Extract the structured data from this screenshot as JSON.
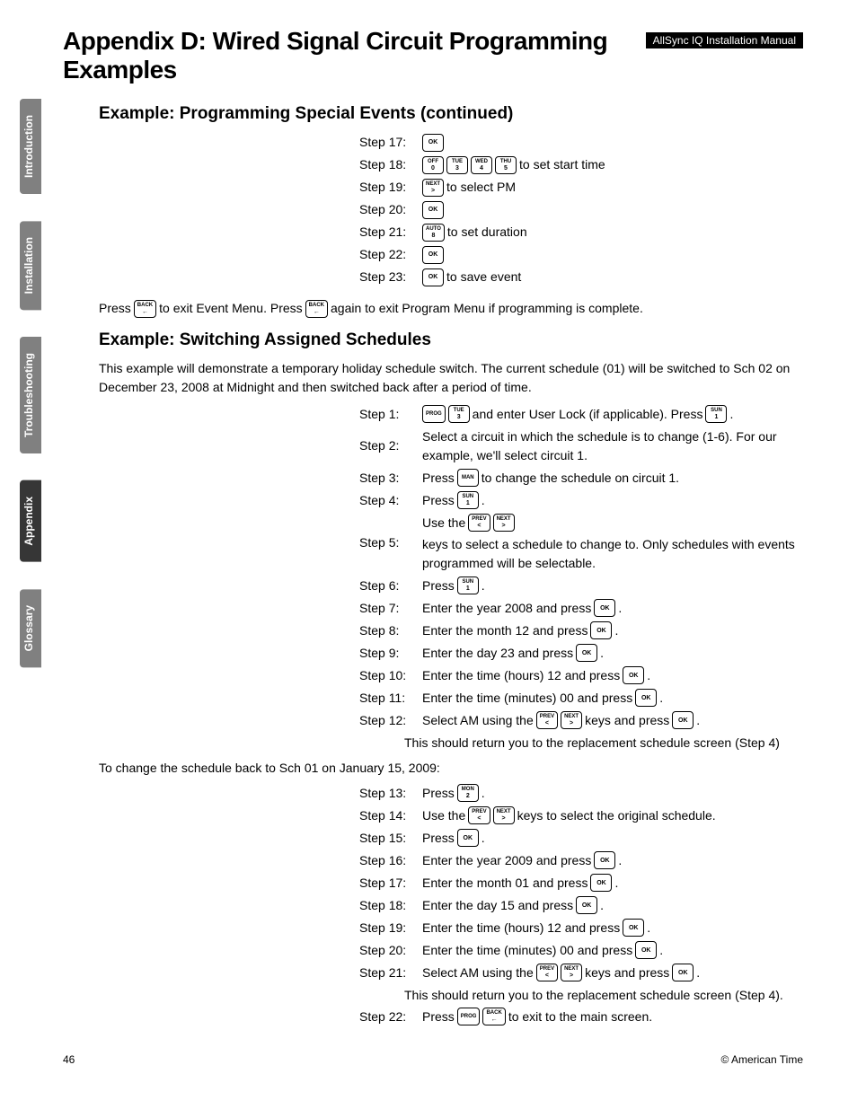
{
  "header": {
    "title": "Appendix D: Wired Signal Circuit Programming Examples",
    "badge": "AllSync IQ Installation Manual"
  },
  "tabs": [
    "Introduction",
    "Installation",
    "Troubleshooting",
    "Appendix",
    "Glossary"
  ],
  "active_tab": "Appendix",
  "section1": {
    "subtitle": "Example: Programming Special Events (continued)",
    "steps": [
      {
        "n": "Step 17:",
        "items": [
          {
            "t": "key",
            "top": "OK"
          }
        ]
      },
      {
        "n": "Step 18:",
        "items": [
          {
            "t": "key",
            "top": "OFF",
            "bot": "0"
          },
          {
            "t": "key",
            "top": "TUE",
            "bot": "3"
          },
          {
            "t": "key",
            "top": "WED",
            "bot": "4"
          },
          {
            "t": "key",
            "top": "THU",
            "bot": "5"
          },
          {
            "t": "text",
            "v": " to set start time"
          }
        ]
      },
      {
        "n": "Step 19:",
        "items": [
          {
            "t": "key",
            "top": "NEXT",
            "bot": ">"
          },
          {
            "t": "text",
            "v": " to select PM"
          }
        ]
      },
      {
        "n": "Step 20:",
        "items": [
          {
            "t": "key",
            "top": "OK"
          }
        ]
      },
      {
        "n": "Step 21:",
        "items": [
          {
            "t": "key",
            "top": "AUTO",
            "bot": "8"
          },
          {
            "t": "text",
            "v": " to set duration"
          }
        ]
      },
      {
        "n": "Step 22:",
        "items": [
          {
            "t": "key",
            "top": "OK"
          }
        ]
      },
      {
        "n": "Step 23:",
        "items": [
          {
            "t": "key",
            "top": "OK"
          },
          {
            "t": "text",
            "v": " to save event"
          }
        ]
      }
    ],
    "exit_line": [
      {
        "t": "text",
        "v": "Press "
      },
      {
        "t": "key",
        "top": "BACK",
        "bot": "←"
      },
      {
        "t": "text",
        "v": " to exit Event Menu. Press "
      },
      {
        "t": "key",
        "top": "BACK",
        "bot": "←"
      },
      {
        "t": "text",
        "v": " again to exit Program Menu if programming is complete."
      }
    ]
  },
  "section2": {
    "subtitle": "Example: Switching Assigned Schedules",
    "intro": "This example will demonstrate a temporary holiday schedule switch. The current schedule (01) will be switched to Sch 02 on December 23, 2008 at Midnight and then switched back after a period of time.",
    "stepsA": [
      {
        "n": "Step 1:",
        "items": [
          {
            "t": "key",
            "top": "PROG"
          },
          {
            "t": "key",
            "top": "TUE",
            "bot": "3"
          },
          {
            "t": "text",
            "v": " and enter User Lock (if applicable). Press "
          },
          {
            "t": "key",
            "top": "SUN",
            "bot": "1"
          },
          {
            "t": "text",
            "v": "."
          }
        ]
      },
      {
        "n": "Step 2:",
        "items": [
          {
            "t": "text",
            "v": "Select a circuit in which the schedule is to change (1-6). For our example, we'll select circuit 1."
          }
        ]
      },
      {
        "n": "Step 3:",
        "items": [
          {
            "t": "text",
            "v": "Press "
          },
          {
            "t": "key",
            "top": "MAN"
          },
          {
            "t": "text",
            "v": " to change the schedule on circuit 1."
          }
        ]
      },
      {
        "n": "Step 4:",
        "items": [
          {
            "t": "text",
            "v": "Press "
          },
          {
            "t": "key",
            "top": "SUN",
            "bot": "1"
          },
          {
            "t": "text",
            "v": "."
          }
        ]
      },
      {
        "n": "Step 5:",
        "items": [
          {
            "t": "text",
            "v": "Use the "
          },
          {
            "t": "key",
            "top": "PREV",
            "bot": "<"
          },
          {
            "t": "key",
            "top": "NEXT",
            "bot": ">"
          },
          {
            "t": "text",
            "v": " keys to select a schedule to change to. Only schedules with events programmed will be selectable."
          }
        ]
      },
      {
        "n": "Step 6:",
        "items": [
          {
            "t": "text",
            "v": "Press "
          },
          {
            "t": "key",
            "top": "SUN",
            "bot": "1"
          },
          {
            "t": "text",
            "v": "."
          }
        ]
      },
      {
        "n": "Step 7:",
        "items": [
          {
            "t": "text",
            "v": "Enter the year 2008 and press "
          },
          {
            "t": "key",
            "top": "OK"
          },
          {
            "t": "text",
            "v": "."
          }
        ]
      },
      {
        "n": "Step 8:",
        "items": [
          {
            "t": "text",
            "v": "Enter the month 12 and press "
          },
          {
            "t": "key",
            "top": "OK"
          },
          {
            "t": "text",
            "v": "."
          }
        ]
      },
      {
        "n": "Step 9:",
        "items": [
          {
            "t": "text",
            "v": "Enter the day 23 and press "
          },
          {
            "t": "key",
            "top": "OK"
          },
          {
            "t": "text",
            "v": "."
          }
        ]
      },
      {
        "n": "Step 10:",
        "items": [
          {
            "t": "text",
            "v": "Enter the time (hours) 12 and press "
          },
          {
            "t": "key",
            "top": "OK"
          },
          {
            "t": "text",
            "v": "."
          }
        ]
      },
      {
        "n": "Step 11:",
        "items": [
          {
            "t": "text",
            "v": "Enter the time (minutes) 00 and press "
          },
          {
            "t": "key",
            "top": "OK"
          },
          {
            "t": "text",
            "v": "."
          }
        ]
      },
      {
        "n": "Step 12:",
        "items": [
          {
            "t": "text",
            "v": "Select AM using the "
          },
          {
            "t": "key",
            "top": "PREV",
            "bot": "<"
          },
          {
            "t": "key",
            "top": "NEXT",
            "bot": ">"
          },
          {
            "t": "text",
            "v": " keys and press "
          },
          {
            "t": "key",
            "top": "OK"
          },
          {
            "t": "text",
            "v": "."
          }
        ]
      }
    ],
    "noteA": "This should return you to the replacement schedule screen (Step 4)",
    "mid_note": "To change the schedule back to Sch 01 on January 15, 2009:",
    "stepsB": [
      {
        "n": "Step 13:",
        "items": [
          {
            "t": "text",
            "v": "Press "
          },
          {
            "t": "key",
            "top": "MON",
            "bot": "2"
          },
          {
            "t": "text",
            "v": "."
          }
        ]
      },
      {
        "n": "Step 14:",
        "items": [
          {
            "t": "text",
            "v": "Use the "
          },
          {
            "t": "key",
            "top": "PREV",
            "bot": "<"
          },
          {
            "t": "key",
            "top": "NEXT",
            "bot": ">"
          },
          {
            "t": "text",
            "v": " keys to select the original schedule."
          }
        ]
      },
      {
        "n": "Step 15:",
        "items": [
          {
            "t": "text",
            "v": "Press "
          },
          {
            "t": "key",
            "top": "OK"
          },
          {
            "t": "text",
            "v": "."
          }
        ]
      },
      {
        "n": "Step 16:",
        "items": [
          {
            "t": "text",
            "v": "Enter the year 2009 and press "
          },
          {
            "t": "key",
            "top": "OK"
          },
          {
            "t": "text",
            "v": "."
          }
        ]
      },
      {
        "n": "Step 17:",
        "items": [
          {
            "t": "text",
            "v": "Enter the month 01 and press "
          },
          {
            "t": "key",
            "top": "OK"
          },
          {
            "t": "text",
            "v": "."
          }
        ]
      },
      {
        "n": "Step 18:",
        "items": [
          {
            "t": "text",
            "v": "Enter the day 15 and press "
          },
          {
            "t": "key",
            "top": "OK"
          },
          {
            "t": "text",
            "v": "."
          }
        ]
      },
      {
        "n": "Step 19:",
        "items": [
          {
            "t": "text",
            "v": "Enter the time (hours) 12 and press "
          },
          {
            "t": "key",
            "top": "OK"
          },
          {
            "t": "text",
            "v": "."
          }
        ]
      },
      {
        "n": "Step 20:",
        "items": [
          {
            "t": "text",
            "v": "Enter the time (minutes) 00 and press "
          },
          {
            "t": "key",
            "top": "OK"
          },
          {
            "t": "text",
            "v": "."
          }
        ]
      },
      {
        "n": "Step 21:",
        "items": [
          {
            "t": "text",
            "v": "Select AM using the "
          },
          {
            "t": "key",
            "top": "PREV",
            "bot": "<"
          },
          {
            "t": "key",
            "top": "NEXT",
            "bot": ">"
          },
          {
            "t": "text",
            "v": " keys and press "
          },
          {
            "t": "key",
            "top": "OK"
          },
          {
            "t": "text",
            "v": "."
          }
        ]
      }
    ],
    "noteB": "This should return you to the replacement schedule screen (Step 4).",
    "stepsC": [
      {
        "n": "Step 22:",
        "items": [
          {
            "t": "text",
            "v": "Press "
          },
          {
            "t": "key",
            "top": "PROG"
          },
          {
            "t": "key",
            "top": "BACK",
            "bot": "←"
          },
          {
            "t": "text",
            "v": " to exit to the main screen."
          }
        ]
      }
    ]
  },
  "footer": {
    "page": "46",
    "copy": "© American Time"
  }
}
